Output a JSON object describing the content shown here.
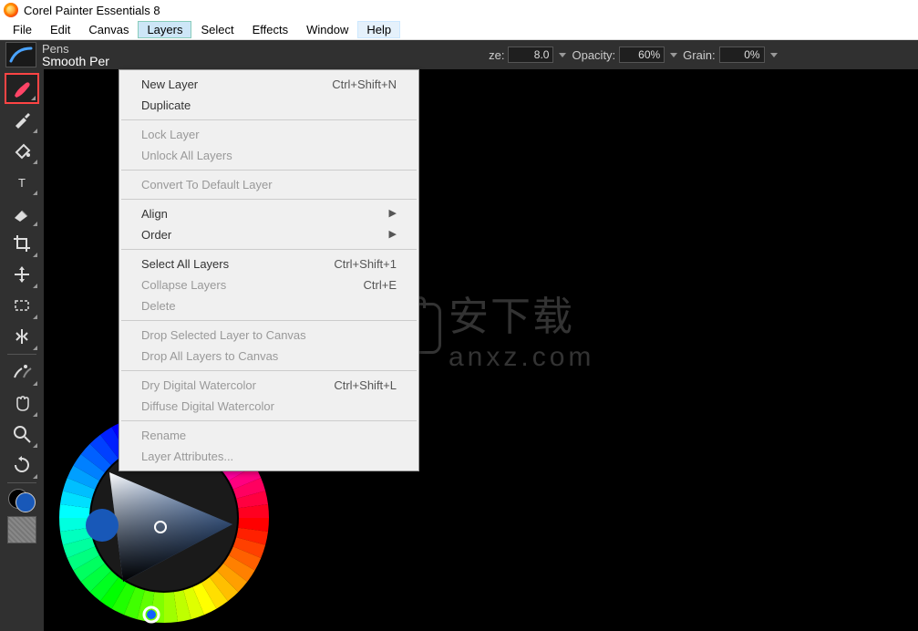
{
  "title": "Corel Painter Essentials 8",
  "menubar": [
    "File",
    "Edit",
    "Canvas",
    "Layers",
    "Select",
    "Effects",
    "Window",
    "Help"
  ],
  "menubar_active": "Layers",
  "menubar_hover": "Help",
  "brush": {
    "category": "Pens",
    "name": "Smooth Per"
  },
  "props": {
    "size_label": "ze:",
    "size_value": "8.0",
    "opacity_label": "Opacity:",
    "opacity_value": "60%",
    "grain_label": "Grain:",
    "grain_value": "0%"
  },
  "layers_menu": [
    {
      "label": "New Layer",
      "shortcut": "Ctrl+Shift+N"
    },
    {
      "label": "Duplicate"
    },
    {
      "sep": true
    },
    {
      "label": "Lock Layer",
      "disabled": true
    },
    {
      "label": "Unlock All Layers",
      "disabled": true
    },
    {
      "sep": true
    },
    {
      "label": "Convert To Default Layer",
      "disabled": true
    },
    {
      "sep": true
    },
    {
      "label": "Align",
      "submenu": true
    },
    {
      "label": "Order",
      "submenu": true
    },
    {
      "sep": true
    },
    {
      "label": "Select All Layers",
      "shortcut": "Ctrl+Shift+1"
    },
    {
      "label": "Collapse Layers",
      "shortcut": "Ctrl+E",
      "disabled": true
    },
    {
      "label": "Delete",
      "disabled": true
    },
    {
      "sep": true
    },
    {
      "label": "Drop Selected Layer to Canvas",
      "disabled": true
    },
    {
      "label": "Drop All Layers to Canvas",
      "disabled": true
    },
    {
      "sep": true
    },
    {
      "label": "Dry Digital Watercolor",
      "shortcut": "Ctrl+Shift+L",
      "disabled": true
    },
    {
      "label": "Diffuse Digital Watercolor",
      "disabled": true
    },
    {
      "sep": true
    },
    {
      "label": "Rename",
      "disabled": true
    },
    {
      "label": "Layer Attributes...",
      "disabled": true
    }
  ],
  "tools": [
    "brush",
    "dropper",
    "paint-bucket",
    "text",
    "eraser",
    "crop",
    "transform",
    "marquee",
    "mirror",
    "symmetry-divider",
    "clone",
    "grab",
    "magnifier",
    "rotate"
  ],
  "watermark_text": "安下载",
  "watermark_sub": "anxz.com",
  "colors": {
    "front": "#1858b8",
    "back": "#000000"
  }
}
